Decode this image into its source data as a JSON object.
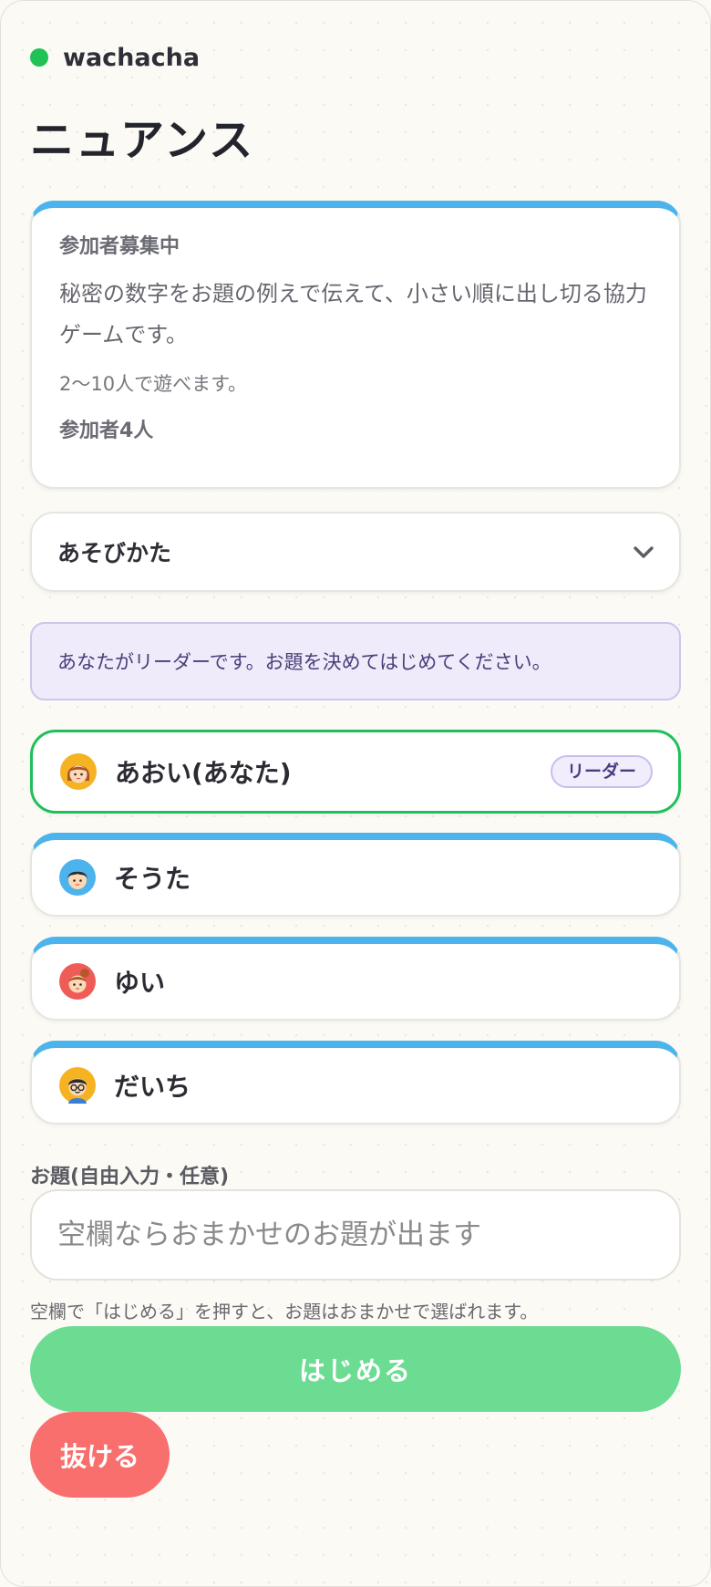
{
  "brand": {
    "name": "wachacha",
    "dot_color": "#1fc254"
  },
  "page": {
    "title": "ニュアンス"
  },
  "info_card": {
    "status": "参加者募集中",
    "description": "秘密の数字をお題の例えで伝えて、小さい順に出し切る協力ゲームです。",
    "player_range": "2〜10人で遊べます。",
    "participants": "参加者4人"
  },
  "howto": {
    "label": "あそびかた",
    "icon": "chevron-down-icon"
  },
  "notice": {
    "text": "あなたがリーダーです。お題を決めてはじめてください。"
  },
  "players": [
    {
      "name": "あおい(あなた)",
      "badge": "リーダー",
      "avatar": "girl-avatar-icon",
      "avatar_color": "#f5b223"
    },
    {
      "name": "そうた",
      "badge": "",
      "avatar": "boy-avatar-icon",
      "avatar_color": "#4db3ec"
    },
    {
      "name": "ゆい",
      "badge": "",
      "avatar": "girl-bun-avatar-icon",
      "avatar_color": "#ef5c57"
    },
    {
      "name": "だいち",
      "badge": "",
      "avatar": "glasses-boy-avatar-icon",
      "avatar_color": "#f5b223"
    }
  ],
  "topic": {
    "label": "お題(自由入力・任意)",
    "value": "",
    "placeholder": "空欄ならおまかせのお題が出ます",
    "hint": "空欄で「はじめる」を押すと、お題はおまかせで選ばれます。"
  },
  "actions": {
    "start_label": "はじめる",
    "leave_label": "抜ける"
  },
  "colors": {
    "accent_green": "#1fc05a",
    "accent_blue": "#4db3ec",
    "danger": "#f86f6d",
    "start_disabled": "#6ddc93"
  }
}
